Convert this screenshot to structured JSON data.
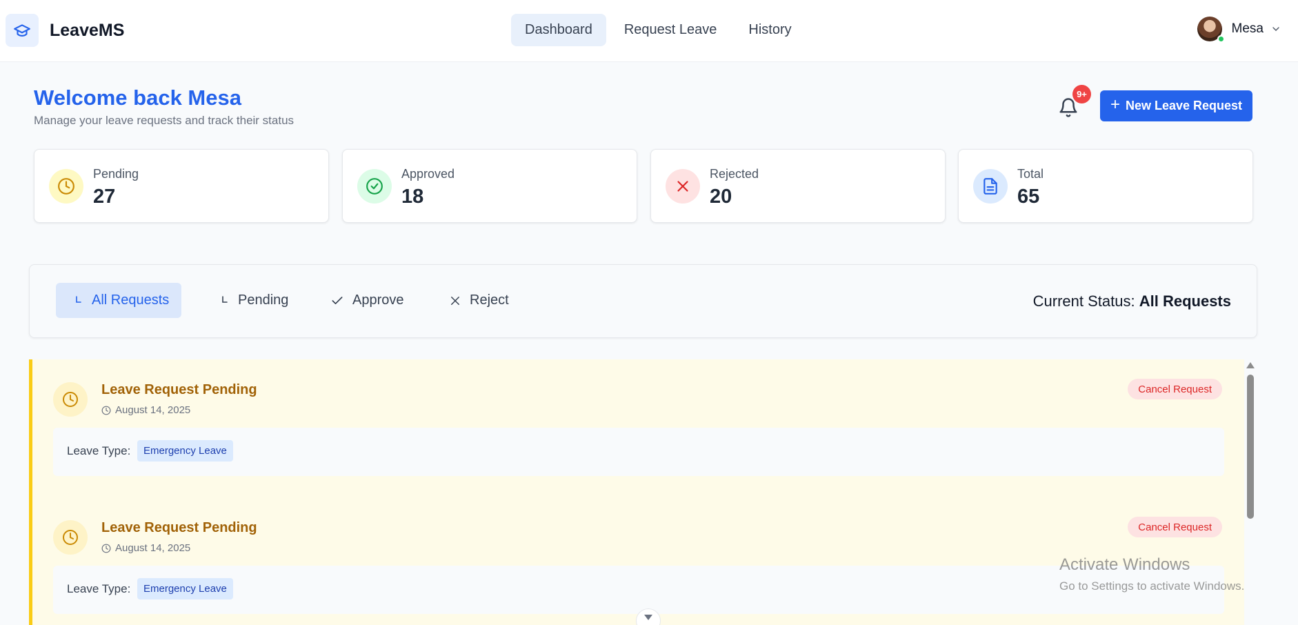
{
  "app": {
    "name": "LeaveMS"
  },
  "nav": {
    "items": [
      "Dashboard",
      "Request Leave",
      "History"
    ],
    "active": "Dashboard"
  },
  "user": {
    "name": "Mesa",
    "status_color": "#22c55e"
  },
  "welcome": {
    "title": "Welcome back Mesa",
    "subtitle": "Manage your leave requests and track their status"
  },
  "notifications": {
    "badge": "9+",
    "icon": "bell-icon"
  },
  "new_request_button": {
    "label": "New Leave Request"
  },
  "stats": [
    {
      "label": "Pending",
      "value": "27",
      "icon": "clock-icon",
      "color": "#ca8a04"
    },
    {
      "label": "Approved",
      "value": "18",
      "icon": "check-circle-icon",
      "color": "#16a34a"
    },
    {
      "label": "Rejected",
      "value": "20",
      "icon": "x-icon",
      "color": "#dc2626"
    },
    {
      "label": "Total",
      "value": "65",
      "icon": "document-icon",
      "color": "#2563eb"
    }
  ],
  "filters": {
    "tabs": [
      "All Requests",
      "Pending",
      "Approve",
      "Reject"
    ],
    "active": "All Requests",
    "current_label": "Current Status:",
    "current_value": "All Requests"
  },
  "requests": [
    {
      "title": "Leave Request Pending",
      "date": "August 14, 2025",
      "cancel_label": "Cancel Request",
      "leave_type_label": "Leave Type:",
      "leave_type": "Emergency Leave"
    },
    {
      "title": "Leave Request Pending",
      "date": "August 14, 2025",
      "cancel_label": "Cancel Request",
      "leave_type_label": "Leave Type:",
      "leave_type": "Emergency Leave"
    }
  ],
  "watermark": {
    "line1": "Activate Windows",
    "line2": "Go to Settings to activate Windows."
  },
  "colors": {
    "primary": "#2563eb",
    "pending_bg": "#fefbe8",
    "pending_accent": "#facc15"
  }
}
